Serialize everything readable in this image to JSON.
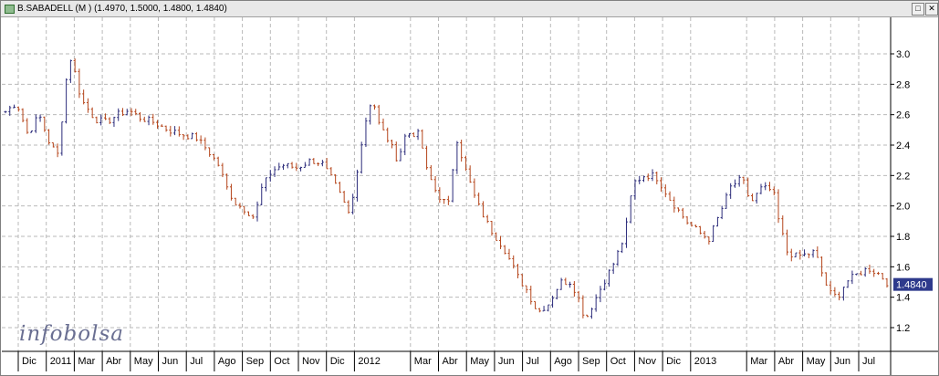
{
  "window": {
    "title": "B.SABADELL  (M )  (1.4970,  1.5000,  1.4800,  1.4840)",
    "restore_glyph": "□",
    "close_glyph": "✕"
  },
  "watermark": "infobolsa",
  "colors": {
    "up": "#2b2b7a",
    "down": "#b5451b",
    "grid": "#b9b9b9",
    "last_label_bg": "#2e3a8c"
  },
  "chart_data": {
    "type": "line",
    "style": "ohlc-bars",
    "title": "B.SABADELL",
    "ylim": [
      1.1,
      3.2
    ],
    "y_ticks": [
      1.2,
      1.4,
      1.6,
      1.8,
      2.0,
      2.2,
      2.4,
      2.6,
      2.8,
      3.0
    ],
    "y_tick_labels": [
      "1.2",
      "1.4",
      "1.6",
      "1.8",
      "2.0",
      "2.2",
      "2.4",
      "2.6",
      "2.8",
      "3.0"
    ],
    "last_value": 1.484,
    "last_value_label": "1.4840",
    "x_tick_labels": [
      "Dic",
      "2011",
      "Mar",
      "Abr",
      "May",
      "Jun",
      "Jul",
      "Ago",
      "Sep",
      "Oct",
      "Nov",
      "Dic",
      "2012",
      "Mar",
      "Abr",
      "May",
      "Jun",
      "Jul",
      "Ago",
      "Sep",
      "Oct",
      "Nov",
      "Dic",
      "2013",
      "Mar",
      "Abr",
      "May",
      "Jun",
      "Jul"
    ],
    "x_tick_index": [
      0,
      1,
      2,
      3,
      4,
      5,
      6,
      7,
      8,
      9,
      10,
      11,
      12,
      14,
      15,
      16,
      17,
      18,
      19,
      20,
      21,
      22,
      23,
      24,
      26,
      27,
      28,
      29,
      30
    ],
    "x_month_count": 31,
    "series": [
      {
        "type": "ohlc",
        "keypoints": [
          [
            0,
            2.62
          ],
          [
            0.4,
            2.68
          ],
          [
            0.8,
            2.47
          ],
          [
            1.2,
            2.6
          ],
          [
            1.6,
            2.4
          ],
          [
            1.9,
            2.33
          ],
          [
            2.1,
            2.75
          ],
          [
            2.3,
            2.98
          ],
          [
            2.45,
            2.9
          ],
          [
            2.7,
            2.7
          ],
          [
            3.2,
            2.57
          ],
          [
            3.6,
            2.55
          ],
          [
            4.0,
            2.6
          ],
          [
            4.4,
            2.63
          ],
          [
            4.8,
            2.58
          ],
          [
            5.3,
            2.55
          ],
          [
            5.8,
            2.5
          ],
          [
            6.3,
            2.47
          ],
          [
            6.8,
            2.45
          ],
          [
            7.2,
            2.37
          ],
          [
            7.6,
            2.27
          ],
          [
            7.9,
            2.12
          ],
          [
            8.2,
            2.02
          ],
          [
            8.6,
            1.97
          ],
          [
            8.9,
            1.92
          ],
          [
            9.1,
            2.1
          ],
          [
            9.5,
            2.23
          ],
          [
            9.9,
            2.27
          ],
          [
            10.4,
            2.25
          ],
          [
            10.9,
            2.3
          ],
          [
            11.3,
            2.28
          ],
          [
            11.7,
            2.16
          ],
          [
            12.0,
            2.05
          ],
          [
            12.3,
            1.93
          ],
          [
            12.6,
            2.3
          ],
          [
            12.9,
            2.6
          ],
          [
            13.1,
            2.72
          ],
          [
            13.3,
            2.55
          ],
          [
            13.7,
            2.42
          ],
          [
            14.0,
            2.3
          ],
          [
            14.3,
            2.48
          ],
          [
            14.8,
            2.47
          ],
          [
            15.0,
            2.25
          ],
          [
            15.4,
            2.08
          ],
          [
            15.8,
            2.0
          ],
          [
            16.1,
            2.45
          ],
          [
            16.4,
            2.25
          ],
          [
            16.8,
            2.03
          ],
          [
            17.3,
            1.85
          ],
          [
            17.8,
            1.72
          ],
          [
            18.3,
            1.53
          ],
          [
            18.6,
            1.45
          ],
          [
            19.0,
            1.3
          ],
          [
            19.4,
            1.36
          ],
          [
            19.8,
            1.5
          ],
          [
            20.2,
            1.5
          ],
          [
            20.5,
            1.37
          ],
          [
            20.7,
            1.25
          ],
          [
            20.9,
            1.33
          ],
          [
            21.3,
            1.48
          ],
          [
            21.7,
            1.62
          ],
          [
            22.1,
            1.8
          ],
          [
            22.4,
            2.15
          ],
          [
            22.8,
            2.2
          ],
          [
            23.2,
            2.2
          ],
          [
            23.7,
            2.05
          ],
          [
            24.3,
            1.9
          ],
          [
            24.8,
            1.82
          ],
          [
            25.1,
            1.78
          ],
          [
            25.5,
            1.95
          ],
          [
            25.9,
            2.13
          ],
          [
            26.3,
            2.18
          ],
          [
            26.6,
            2.02
          ],
          [
            27.0,
            2.12
          ],
          [
            27.4,
            2.1
          ],
          [
            27.6,
            1.9
          ],
          [
            27.9,
            1.7
          ],
          [
            28.2,
            1.67
          ],
          [
            28.6,
            1.68
          ],
          [
            28.9,
            1.7
          ],
          [
            29.1,
            1.58
          ],
          [
            29.4,
            1.43
          ],
          [
            29.7,
            1.4
          ],
          [
            30.0,
            1.5
          ],
          [
            30.4,
            1.55
          ],
          [
            30.8,
            1.59
          ],
          [
            31.2,
            1.55
          ],
          [
            31.6,
            1.47
          ],
          [
            32.0,
            1.43
          ],
          [
            32.3,
            1.35
          ],
          [
            32.6,
            1.28
          ],
          [
            32.8,
            1.45
          ],
          [
            33.0,
            1.56
          ],
          [
            33.3,
            1.5
          ],
          [
            33.5,
            1.484
          ]
        ]
      }
    ]
  }
}
